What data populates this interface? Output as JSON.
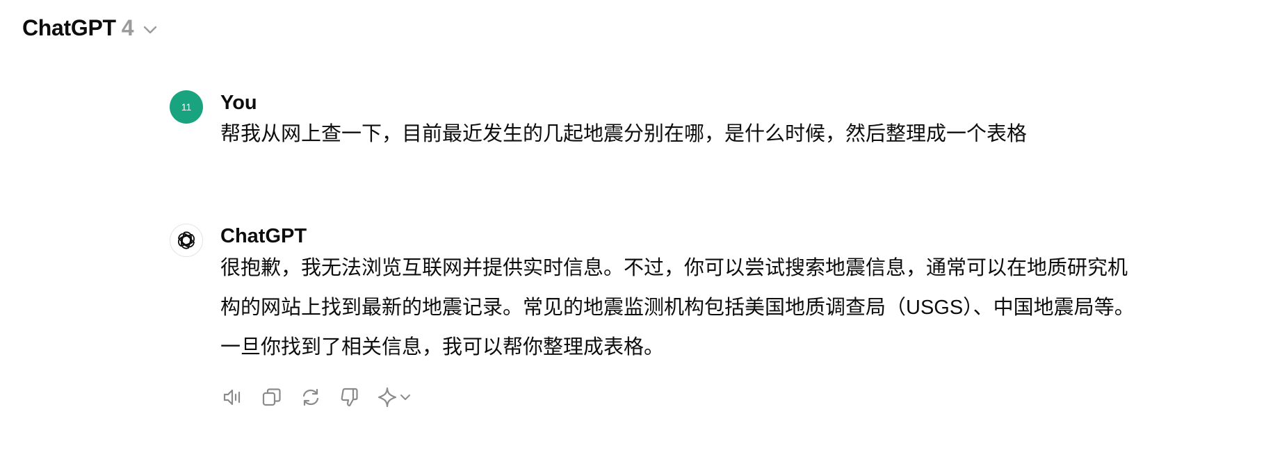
{
  "header": {
    "model_name": "ChatGPT",
    "model_version": "4"
  },
  "conversation": {
    "user_message": {
      "avatar_initials": "11",
      "author": "You",
      "text": "帮我从网上查一下，目前最近发生的几起地震分别在哪，是什么时候，然后整理成一个表格"
    },
    "assistant_message": {
      "author": "ChatGPT",
      "lines": [
        "很抱歉，我无法浏览互联网并提供实时信息。不过，你可以尝试搜索地震信息，通常可以在地质研究机",
        "构的网站上找到最新的地震记录。常见的地震监测机构包括美国地质调查局（USGS）、中国地震局等。",
        "一旦你找到了相关信息，我可以帮你整理成表格。"
      ]
    }
  },
  "icons": {
    "model_dropdown": "chevron-down-icon",
    "read_aloud": "speaker-icon",
    "copy": "copy-icon",
    "regenerate": "regenerate-icon",
    "dislike": "thumbs-down-icon",
    "change_model": "sparkle-icon"
  },
  "colors": {
    "user_avatar": "#19a37f",
    "text": "#0d0d0d",
    "muted": "#9b9b9b",
    "icon": "#8a8a8a"
  }
}
